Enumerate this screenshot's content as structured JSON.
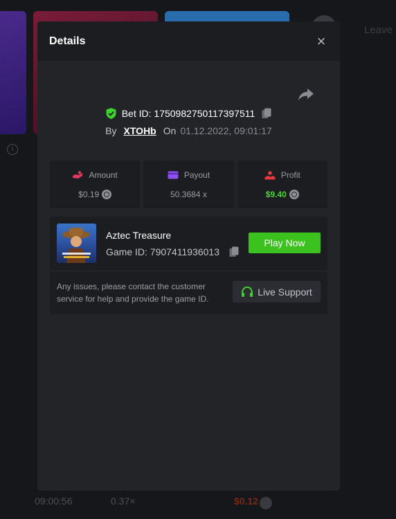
{
  "background": {
    "leave_label": "Leave",
    "row": {
      "time": "09:00:56",
      "multiplier": "0.37×",
      "amount": "$0.12"
    }
  },
  "modal": {
    "title": "Details",
    "close_label": "×",
    "bet": {
      "label": "Bet ID: 1750982750117397511"
    },
    "by": {
      "by_label": "By",
      "user": "XTOHb",
      "on_label": "On",
      "date": "01.12.2022, 09:01:17"
    },
    "stats": [
      {
        "label": "Amount",
        "value": "$0.19",
        "icon": "amount-hand-icon"
      },
      {
        "label": "Payout",
        "value": "50.3684 x",
        "icon": "card-icon"
      },
      {
        "label": "Profit",
        "value": "$9.40",
        "icon": "profit-hand-icon"
      }
    ],
    "game": {
      "name": "Aztec Treasure",
      "id_label": "Game ID: 7907411936013",
      "play_label": "Play Now",
      "issue_text": "Any issues, please contact the customer service for help and provide the game ID.",
      "support_label": "Live Support"
    }
  },
  "colors": {
    "accent_green": "#3cc21e",
    "profit_green": "#4dd43a",
    "shield_green": "#3cd32a"
  }
}
